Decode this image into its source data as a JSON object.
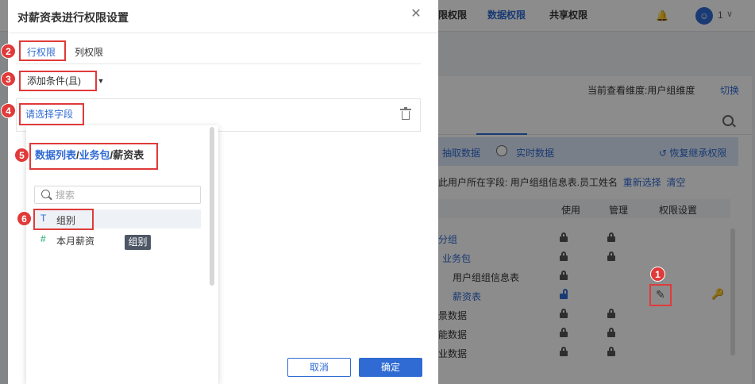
{
  "background": {
    "user_label": "1",
    "dimension_prefix": "当前查看维度:",
    "dimension_value": "用户组维度",
    "switch_label": "切换",
    "tabs": [
      "限权限",
      "数据权限",
      "共享权限"
    ],
    "mode_extract": "抽取数据",
    "mode_realtime": "实时数据",
    "restore_label": "恢复继承权限",
    "field_prefix": "此用户所在字段:",
    "field_value": "用户组组信息表.员工姓名",
    "reselect": "重新选择",
    "clear": "清空",
    "columns": {
      "use": "使用",
      "manage": "管理",
      "perm": "权限设置"
    },
    "rows": [
      {
        "label": "表分组",
        "blue": true
      },
      {
        "label": "业务包",
        "blue": true
      },
      {
        "label": "用户组组信息表",
        "blue": false
      },
      {
        "label": "薪资表",
        "blue": true
      },
      {
        "label": "场景数据",
        "blue": false
      },
      {
        "label": "功能数据",
        "blue": false
      },
      {
        "label": "行业数据",
        "blue": false
      }
    ]
  },
  "dialog": {
    "title": "对薪资表进行权限设置",
    "close_glyph": "✕",
    "tabs": {
      "row": "行权限",
      "column": "列权限"
    },
    "condition_dropdown": "添加条件(且)",
    "field_picker": "请选择字段",
    "breadcrumb": {
      "part1": "数据列表",
      "sep1": "/",
      "part2": "业务包",
      "sep2": "/",
      "part3": "薪资表"
    },
    "search_placeholder": "搜索",
    "fields": [
      {
        "type_glyph": "T",
        "label": "组别"
      },
      {
        "type_glyph": "#",
        "label": "本月薪资"
      }
    ],
    "tooltip": "组别",
    "cancel": "取消",
    "confirm": "确定"
  },
  "badges": [
    "1",
    "2",
    "3",
    "4",
    "5",
    "6"
  ],
  "colors": {
    "accent": "#2f6bd3",
    "annotation": "#e03a3a"
  }
}
